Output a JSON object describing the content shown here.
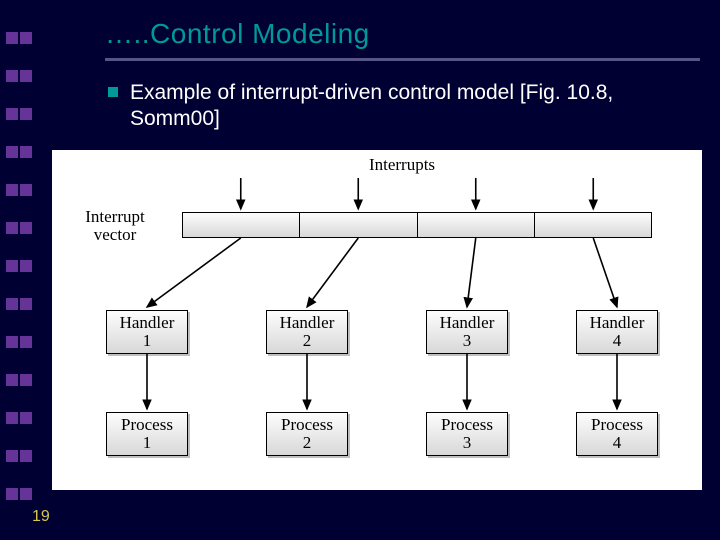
{
  "slide": {
    "title": "…..Control Modeling",
    "bullet": "Example of interrupt-driven control model [Fig. 10.8, Somm00]",
    "page_number": "19"
  },
  "diagram": {
    "top_label": "Interrupts",
    "vector_label_line1": "Interrupt",
    "vector_label_line2": "vector",
    "vector_cells": 4,
    "columns": [
      {
        "handler": "Handler\n1",
        "process": "Process\n1"
      },
      {
        "handler": "Handler\n2",
        "process": "Process\n2"
      },
      {
        "handler": "Handler\n3",
        "process": "Process\n3"
      },
      {
        "handler": "Handler\n4",
        "process": "Process\n4"
      }
    ]
  },
  "decoration": {
    "side_square_count": 26
  }
}
